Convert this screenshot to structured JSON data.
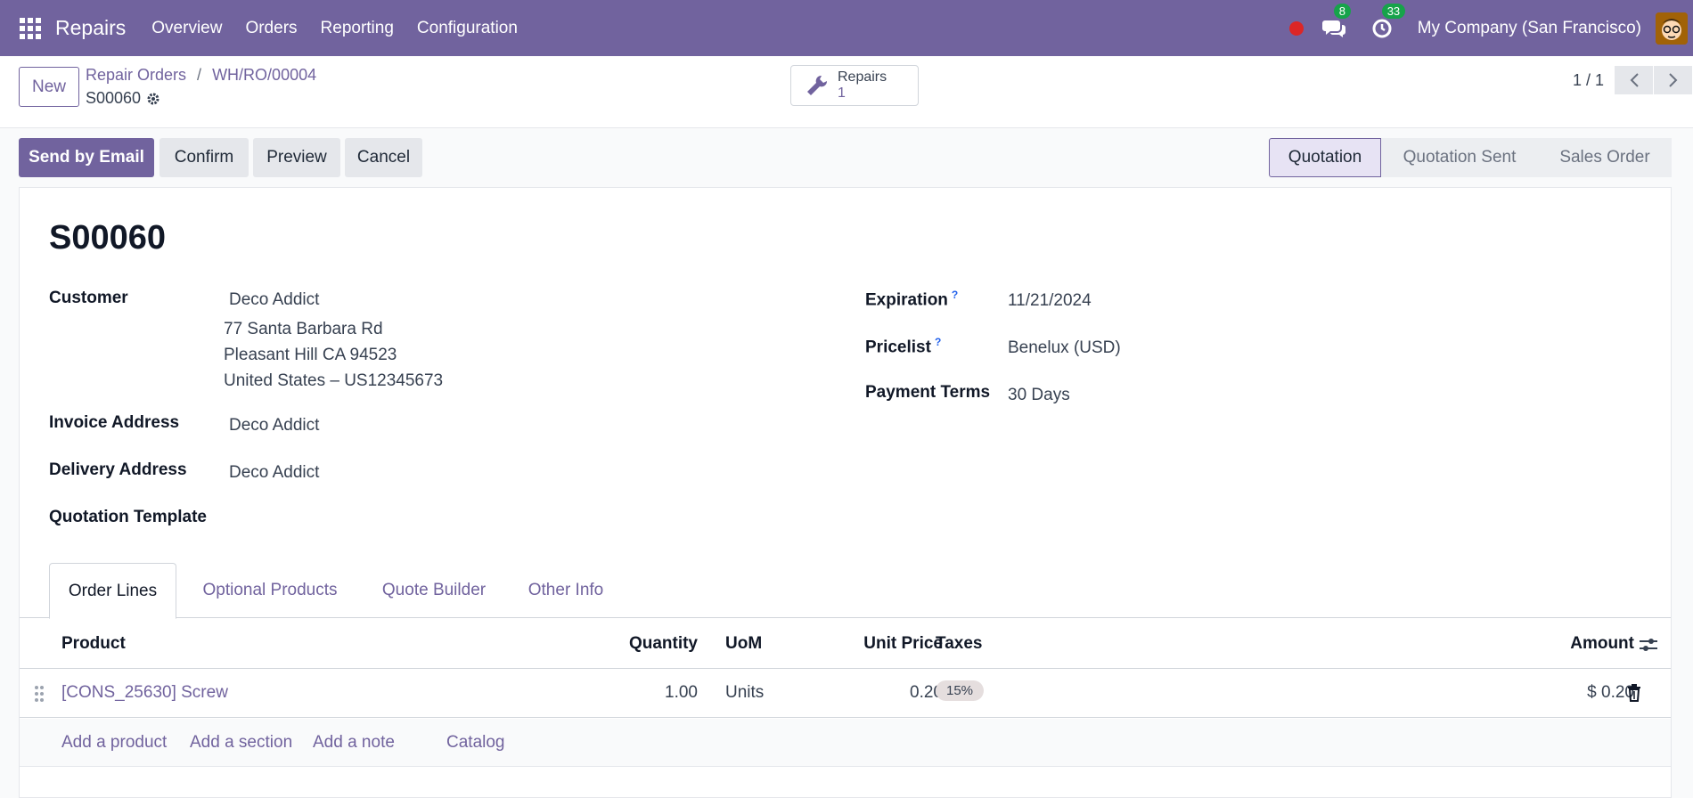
{
  "navbar": {
    "brand": "Repairs",
    "menu": [
      "Overview",
      "Orders",
      "Reporting",
      "Configuration"
    ],
    "messages_count": "8",
    "activities_count": "33",
    "company": "My Company (San Francisco)"
  },
  "control": {
    "new_label": "New",
    "breadcrumb": [
      "Repair Orders",
      "WH/RO/00004"
    ],
    "record_name": "S00060",
    "smart_button": {
      "label": "Repairs",
      "value": "1"
    },
    "pager": "1 / 1"
  },
  "actions": {
    "send_email": "Send by Email",
    "confirm": "Confirm",
    "preview": "Preview",
    "cancel": "Cancel"
  },
  "status_stages": [
    "Quotation",
    "Quotation Sent",
    "Sales Order"
  ],
  "status_active": "Quotation",
  "form": {
    "title": "S00060",
    "customer_label": "Customer",
    "customer_name": "Deco Addict",
    "customer_address": [
      "77 Santa Barbara Rd",
      "Pleasant Hill CA 94523",
      "United States – US12345673"
    ],
    "invoice_label": "Invoice Address",
    "invoice_value": "Deco Addict",
    "delivery_label": "Delivery Address",
    "delivery_value": "Deco Addict",
    "template_label": "Quotation Template",
    "expiration_label": "Expiration",
    "expiration_value": "11/21/2024",
    "pricelist_label": "Pricelist",
    "pricelist_value": "Benelux (USD)",
    "payment_label": "Payment Terms",
    "payment_value": "30 Days",
    "help_mark": "?"
  },
  "tabs": [
    "Order Lines",
    "Optional Products",
    "Quote Builder",
    "Other Info"
  ],
  "table": {
    "headers": {
      "product": "Product",
      "quantity": "Quantity",
      "uom": "UoM",
      "unit_price": "Unit Price",
      "taxes": "Taxes",
      "amount": "Amount"
    },
    "rows": [
      {
        "product": "[CONS_25630] Screw",
        "quantity": "1.00",
        "uom": "Units",
        "unit_price": "0.20",
        "tax": "15%",
        "amount": "$ 0.20"
      }
    ],
    "add_links": [
      "Add a product",
      "Add a section",
      "Add a note",
      "Catalog"
    ]
  }
}
